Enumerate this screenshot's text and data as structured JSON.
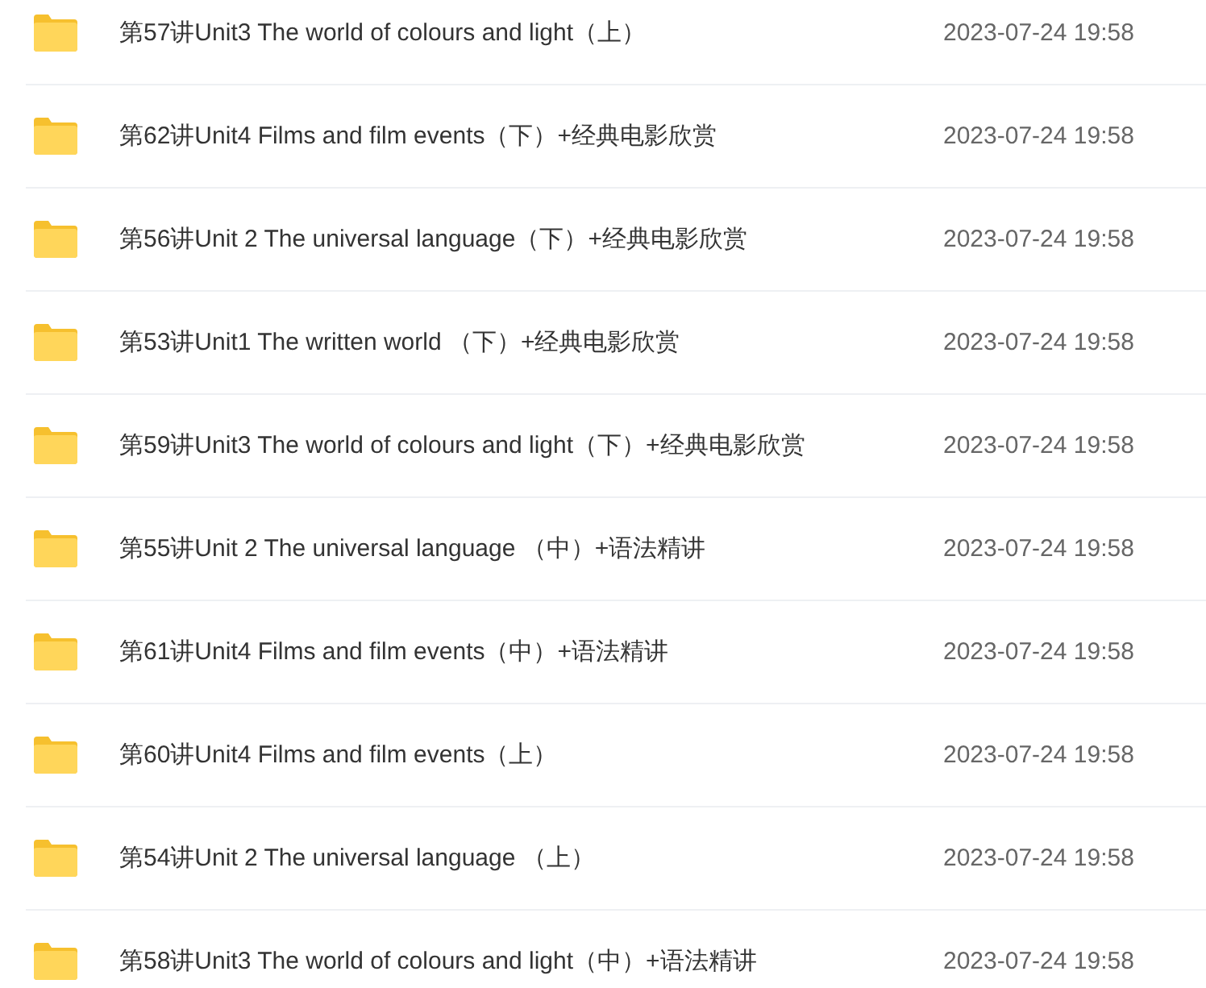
{
  "files": [
    {
      "name": "第57讲Unit3 The world of colours and light（上）",
      "modified": "2023-07-24 19:58"
    },
    {
      "name": "第62讲Unit4 Films and film events（下）+经典电影欣赏",
      "modified": "2023-07-24 19:58"
    },
    {
      "name": "第56讲Unit 2 The universal language（下）+经典电影欣赏",
      "modified": "2023-07-24 19:58"
    },
    {
      "name": "第53讲Unit1 The written world （下）+经典电影欣赏",
      "modified": "2023-07-24 19:58"
    },
    {
      "name": "第59讲Unit3 The world of colours and light（下）+经典电影欣赏",
      "modified": "2023-07-24 19:58"
    },
    {
      "name": "第55讲Unit 2 The universal language （中）+语法精讲",
      "modified": "2023-07-24 19:58"
    },
    {
      "name": "第61讲Unit4 Films and film events（中）+语法精讲",
      "modified": "2023-07-24 19:58"
    },
    {
      "name": "第60讲Unit4 Films and film events（上）",
      "modified": "2023-07-24 19:58"
    },
    {
      "name": "第54讲Unit 2 The universal language （上）",
      "modified": "2023-07-24 19:58"
    },
    {
      "name": "第58讲Unit3 The world of colours and light（中）+语法精讲",
      "modified": "2023-07-24 19:58"
    }
  ]
}
